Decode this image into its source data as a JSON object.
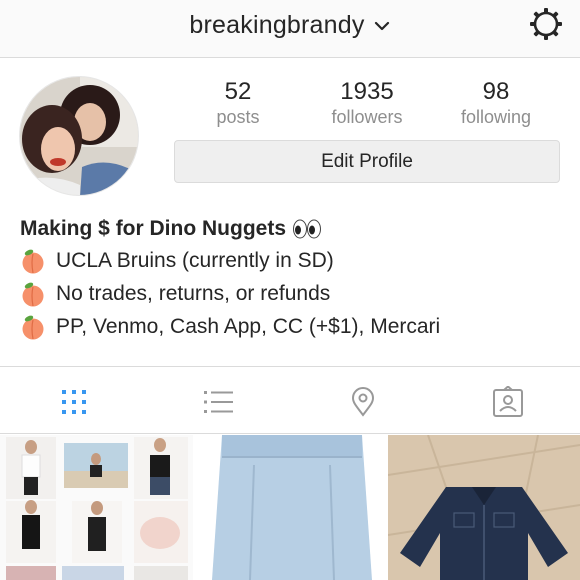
{
  "header": {
    "username": "breakingbrandy"
  },
  "profile": {
    "stats": [
      {
        "value": "52",
        "label": "posts"
      },
      {
        "value": "1935",
        "label": "followers"
      },
      {
        "value": "98",
        "label": "following"
      }
    ],
    "edit_button": "Edit Profile"
  },
  "bio": {
    "name": "Making $ for Dino Nuggets",
    "lines": [
      "UCLA Bruins (currently in SD)",
      "No trades, returns, or refunds",
      "PP, Venmo, Cash App, CC (+$1), Mercari"
    ]
  },
  "tabs": [
    "grid-tab",
    "list-tab",
    "location-tab",
    "tagged-tab"
  ],
  "colors": {
    "active_tab": "#3897f0",
    "inactive_tab": "#999999",
    "text": "#262626",
    "secondary": "#8e8e8e"
  }
}
